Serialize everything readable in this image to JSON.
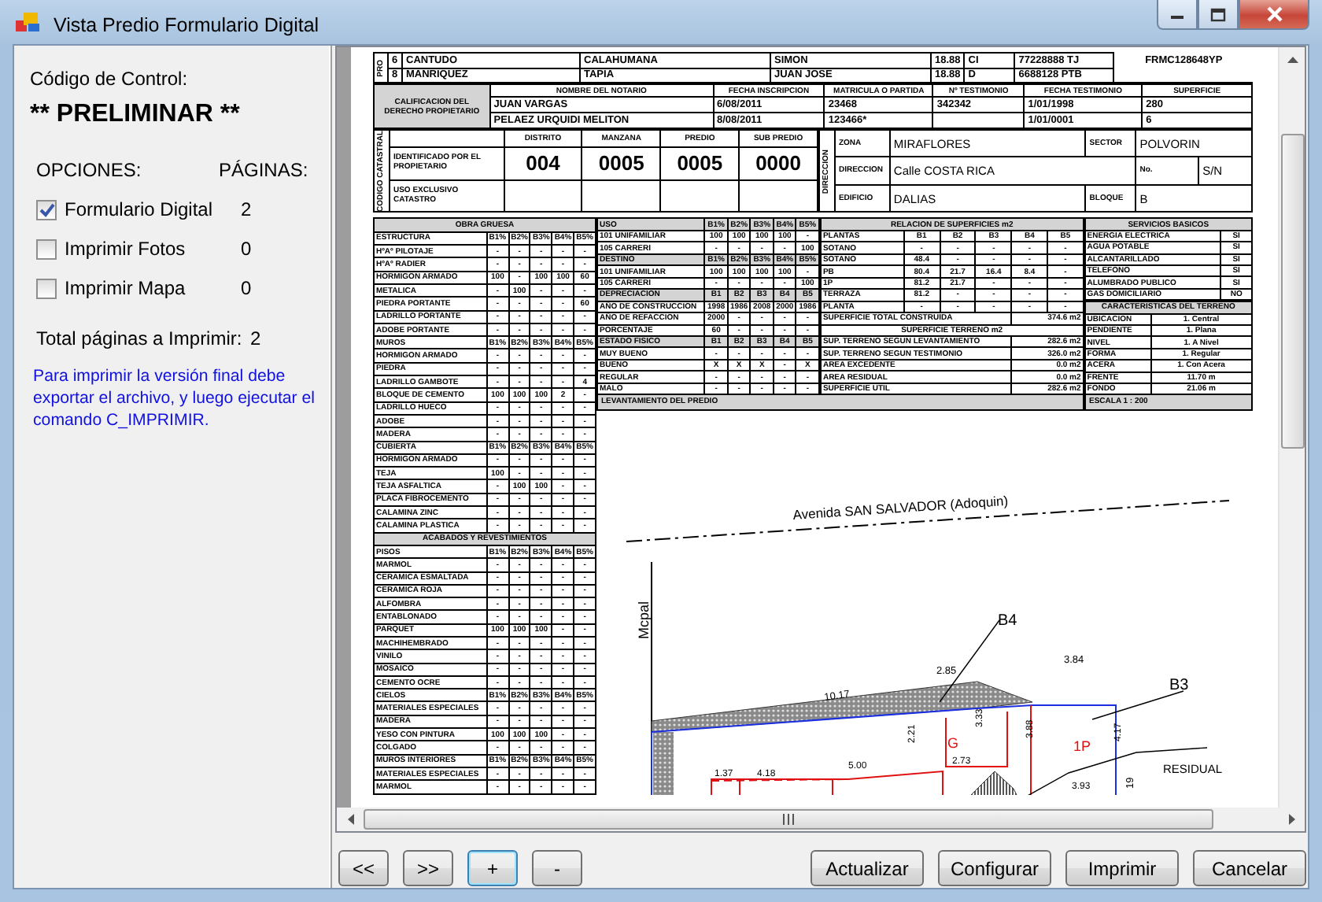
{
  "window": {
    "title": "Vista Predio Formulario Digital"
  },
  "control_panel": {
    "code_label": "Código de Control:",
    "code": "** PRELIMINAR **",
    "options_heading": "OPCIONES:",
    "pages_heading": "PÁGINAS:",
    "options": [
      {
        "label": "Formulario Digital",
        "checked": true,
        "pages": "2"
      },
      {
        "label": "Imprimir Fotos",
        "checked": false,
        "pages": "0"
      },
      {
        "label": "Imprimir Mapa",
        "checked": false,
        "pages": "0"
      }
    ],
    "total_label": "Total páginas a Imprimir:",
    "total": "2",
    "note": "Para imprimir la versión final debe exportar el archivo, y luego ejecutar el comando C_IMPRIMIR."
  },
  "document": {
    "owners": {
      "side_label": "PRO",
      "rows": [
        [
          "6",
          "CANTUDO",
          "CALAHUMANA",
          "SIMON",
          "18.88",
          "CI",
          "77228888 TJ"
        ],
        [
          "8",
          "MANRIQUEZ",
          "TAPIA",
          "JUAN JOSE",
          "18.88",
          "D",
          "6688128 PTB"
        ]
      ]
    },
    "form_code": "FRMC128648YP",
    "rights": {
      "label": "CALIFICACION DEL DERECHO PROPIETARIO",
      "columns": [
        "NOMBRE DEL NOTARIO",
        "FECHA INSCRIPCION",
        "MATRICULA O PARTIDA",
        "Nº TESTIMONIO",
        "FECHA TESTIMONIO",
        "SUPERFICIE"
      ],
      "rows": [
        [
          "JUAN VARGAS",
          "6/08/2011",
          "23468",
          "342342",
          "1/01/1998",
          "280"
        ],
        [
          "PELAEZ URQUIDI MELITON",
          "8/08/2011",
          "123466*",
          null,
          "1/01/0001",
          "6"
        ]
      ]
    },
    "cadastral": {
      "side_label": "CODIGO CATASTRAL",
      "columns": [
        "DISTRITO",
        "MANZANA",
        "PREDIO",
        "SUB PREDIO"
      ],
      "rows": [
        {
          "label": "IDENTIFICADO POR EL PROPIETARIO",
          "values": [
            "004",
            "0005",
            "0005",
            "0000"
          ]
        },
        {
          "label": "USO EXCLUSIVO CATASTRO"
        }
      ]
    },
    "address": {
      "side_label": "DIRECCION",
      "lines": [
        {
          "fields": [
            {
              "label": "ZONA",
              "value": "MIRAFLORES"
            },
            {
              "label": "SECTOR",
              "value": "POLVORIN"
            }
          ]
        },
        {
          "fields": [
            {
              "label": "DIRECCION",
              "value": "Calle COSTA RICA"
            },
            {
              "label": "No.",
              "value": "S/N"
            }
          ]
        },
        {
          "fields": [
            {
              "label": "EDIFICIO",
              "value": "DALIAS"
            },
            {
              "label": "BLOQUE",
              "value": "B"
            }
          ]
        }
      ]
    },
    "construction": {
      "rows": [
        {
          "shaded": true,
          "heading": "OBRA GRUESA"
        },
        {
          "shaded": false,
          "cells": [
            "ESTRUCTURA",
            "B1%",
            "B2%",
            "B3%",
            "B4%",
            "B5%"
          ]
        },
        {
          "shaded": false,
          "cells": [
            "HºAº PILOTAJE",
            "-",
            "-",
            "-",
            "-",
            "-"
          ]
        },
        {
          "shaded": false,
          "cells": [
            "HºAº RADIER",
            "-",
            "-",
            "-",
            "-",
            "-"
          ]
        },
        {
          "shaded": false,
          "cells": [
            "HORMIGON ARMADO",
            "100",
            "-",
            "100",
            "100",
            "60"
          ]
        },
        {
          "shaded": false,
          "cells": [
            "METALICA",
            "-",
            "100",
            "-",
            "-",
            "-"
          ]
        },
        {
          "shaded": false,
          "cells": [
            "PIEDRA PORTANTE",
            "-",
            "-",
            "-",
            "-",
            "60"
          ]
        },
        {
          "shaded": false,
          "cells": [
            "LADRILLO PORTANTE",
            "-",
            "-",
            "-",
            "-",
            "-"
          ]
        },
        {
          "shaded": false,
          "cells": [
            "ADOBE PORTANTE",
            "-",
            "-",
            "-",
            "-",
            "-"
          ]
        },
        {
          "shaded": false,
          "cells": [
            "MUROS",
            "B1%",
            "B2%",
            "B3%",
            "B4%",
            "B5%"
          ]
        },
        {
          "shaded": false,
          "cells": [
            "HORMIGON ARMADO",
            "-",
            "-",
            "-",
            "-",
            "-"
          ]
        },
        {
          "shaded": false,
          "cells": [
            "PIEDRA",
            "-",
            "-",
            "-",
            "-",
            "-"
          ]
        },
        {
          "shaded": false,
          "cells": [
            "LADRILLO GAMBOTE",
            "-",
            "-",
            "-",
            "-",
            "4"
          ]
        },
        {
          "shaded": false,
          "cells": [
            "BLOQUE DE CEMENTO",
            "100",
            "100",
            "100",
            "2",
            "-"
          ]
        },
        {
          "shaded": false,
          "cells": [
            "LADRILLO HUECO",
            "-",
            "-",
            "-",
            "-",
            "-"
          ]
        },
        {
          "shaded": false,
          "cells": [
            "ADOBE",
            "-",
            "-",
            "-",
            "-",
            "-"
          ]
        },
        {
          "shaded": false,
          "cells": [
            "MADERA",
            "-",
            "-",
            "-",
            "-",
            "-"
          ]
        },
        {
          "shaded": false,
          "cells": [
            "CUBIERTA",
            "B1%",
            "B2%",
            "B3%",
            "B4%",
            "B5%"
          ]
        },
        {
          "shaded": false,
          "cells": [
            "HORMIGON ARMADO",
            "-",
            "-",
            "-",
            "-",
            "-"
          ]
        },
        {
          "shaded": false,
          "cells": [
            "TEJA",
            "100",
            "-",
            "-",
            "-",
            "-"
          ]
        },
        {
          "shaded": false,
          "cells": [
            "TEJA ASFALTICA",
            "-",
            "100",
            "100",
            "-",
            "-"
          ]
        },
        {
          "shaded": false,
          "cells": [
            "PLACA FIBROCEMENTO",
            "-",
            "-",
            "-",
            "-",
            "-"
          ]
        },
        {
          "shaded": false,
          "cells": [
            "CALAMINA ZINC",
            "-",
            "-",
            "-",
            "-",
            "-"
          ]
        },
        {
          "shaded": false,
          "cells": [
            "CALAMINA PLASTICA",
            "-",
            "-",
            "-",
            "-",
            "-"
          ]
        },
        {
          "shaded": true,
          "heading": "ACABADOS Y REVESTIMIENTOS"
        },
        {
          "shaded": false,
          "cells": [
            "PISOS",
            "B1%",
            "B2%",
            "B3%",
            "B4%",
            "B5%"
          ]
        },
        {
          "shaded": false,
          "cells": [
            "MARMOL",
            "-",
            "-",
            "-",
            "-",
            "-"
          ]
        },
        {
          "shaded": false,
          "cells": [
            "CERAMICA ESMALTADA",
            "-",
            "-",
            "-",
            "-",
            "-"
          ]
        },
        {
          "shaded": false,
          "cells": [
            "CERAMICA ROJA",
            "-",
            "-",
            "-",
            "-",
            "-"
          ]
        },
        {
          "shaded": false,
          "cells": [
            "ALFOMBRA",
            "-",
            "-",
            "-",
            "-",
            "-"
          ]
        },
        {
          "shaded": false,
          "cells": [
            "ENTABLONADO",
            "-",
            "-",
            "-",
            "-",
            "-"
          ]
        },
        {
          "shaded": false,
          "cells": [
            "PARQUET",
            "100",
            "100",
            "100",
            "-",
            "-"
          ]
        },
        {
          "shaded": false,
          "cells": [
            "MACHIHEMBRADO",
            "-",
            "-",
            "-",
            "-",
            "-"
          ]
        },
        {
          "shaded": false,
          "cells": [
            "VINILO",
            "-",
            "-",
            "-",
            "-",
            "-"
          ]
        },
        {
          "shaded": false,
          "cells": [
            "MOSAICO",
            "-",
            "-",
            "-",
            "-",
            "-"
          ]
        },
        {
          "shaded": false,
          "cells": [
            "CEMENTO OCRE",
            "-",
            "-",
            "-",
            "-",
            "-"
          ]
        },
        {
          "shaded": false,
          "cells": [
            "CIELOS",
            "B1%",
            "B2%",
            "B3%",
            "B4%",
            "B5%"
          ]
        },
        {
          "shaded": false,
          "cells": [
            "MATERIALES ESPECIALES",
            "-",
            "-",
            "-",
            "-",
            "-"
          ]
        },
        {
          "shaded": false,
          "cells": [
            "MADERA",
            "-",
            "-",
            "-",
            "-",
            "-"
          ]
        },
        {
          "shaded": false,
          "cells": [
            "YESO CON PINTURA",
            "100",
            "100",
            "100",
            "-",
            "-"
          ]
        },
        {
          "shaded": false,
          "cells": [
            "COLGADO",
            "-",
            "-",
            "-",
            "-",
            "-"
          ]
        },
        {
          "shaded": false,
          "cells": [
            "MUROS INTERIORES",
            "B1%",
            "B2%",
            "B3%",
            "B4%",
            "B5%"
          ]
        },
        {
          "shaded": false,
          "cells": [
            "MATERIALES ESPECIALES",
            "-",
            "-",
            "-",
            "-",
            "-"
          ]
        },
        {
          "shaded": false,
          "cells": [
            "MARMOL",
            "-",
            "-",
            "-",
            "-",
            "-"
          ]
        }
      ]
    },
    "use": {
      "rows": [
        {
          "shaded": true,
          "cells": [
            "USO",
            "B1%",
            "B2%",
            "B3%",
            "B4%",
            "B5%"
          ]
        },
        {
          "shaded": false,
          "cells": [
            "101 UNIFAMILIAR",
            "100",
            "100",
            "100",
            "100",
            "-"
          ]
        },
        {
          "shaded": false,
          "cells": [
            "105 CARRERI",
            "-",
            "-",
            "-",
            "-",
            "100"
          ]
        },
        {
          "shaded": true,
          "cells": [
            "DESTINO",
            "B1%",
            "B2%",
            "B3%",
            "B4%",
            "B5%"
          ]
        },
        {
          "shaded": false,
          "cells": [
            "101 UNIFAMILIAR",
            "100",
            "100",
            "100",
            "100",
            "-"
          ]
        },
        {
          "shaded": false,
          "cells": [
            "105 CARRERI",
            "-",
            "-",
            "-",
            "-",
            "100"
          ]
        },
        {
          "shaded": true,
          "cells": [
            "DEPRECIACION",
            "B1",
            "B2",
            "B3",
            "B4",
            "B5"
          ]
        },
        {
          "shaded": false,
          "cells": [
            "AÑO DE CONSTRUCCION",
            "1998",
            "1986",
            "2008",
            "2000",
            "1986"
          ]
        },
        {
          "shaded": false,
          "cells": [
            "AÑO DE REFACCION",
            "2000",
            "-",
            "-",
            "-",
            "-"
          ]
        },
        {
          "shaded": false,
          "cells": [
            "PORCENTAJE",
            "60",
            "-",
            "-",
            "-",
            "-"
          ]
        },
        {
          "shaded": true,
          "cells": [
            "ESTADO FISICO",
            "B1",
            "B2",
            "B3",
            "B4",
            "B5"
          ]
        },
        {
          "shaded": false,
          "cells": [
            "MUY BUENO",
            "-",
            "-",
            "-",
            "-",
            "-"
          ]
        },
        {
          "shaded": false,
          "cells": [
            "BUENO",
            "X",
            "X",
            "X",
            "-",
            "X"
          ]
        },
        {
          "shaded": false,
          "cells": [
            "REGULAR",
            "-",
            "-",
            "-",
            "-",
            "-"
          ]
        },
        {
          "shaded": false,
          "cells": [
            "MALO",
            "-",
            "-",
            "-",
            "-",
            "-"
          ]
        }
      ]
    },
    "surfaces": {
      "rows": [
        {
          "shaded": true,
          "heading": "RELACION DE SUPERFICIES m2"
        },
        {
          "shaded": false,
          "cells": [
            "PLANTAS",
            "B1",
            "B2",
            "B3",
            "B4",
            "B5"
          ]
        },
        {
          "shaded": false,
          "cells": [
            "SOTANO",
            "-",
            "-",
            "-",
            "-",
            "-"
          ]
        },
        {
          "shaded": false,
          "cells": [
            "SOTANO",
            "48.4",
            "-",
            "-",
            "-",
            "-"
          ]
        },
        {
          "shaded": false,
          "cells": [
            "PB",
            "80.4",
            "21.7",
            "16.4",
            "8.4",
            "-"
          ]
        },
        {
          "shaded": false,
          "cells": [
            "1P",
            "81.2",
            "21.7",
            "-",
            "-",
            "-"
          ]
        },
        {
          "shaded": false,
          "cells": [
            "TERRAZA",
            "81.2",
            "-",
            "-",
            "-",
            "-"
          ]
        },
        {
          "shaded": false,
          "cells": [
            "PLANTA",
            "-",
            "-",
            "-",
            "-",
            "-"
          ]
        },
        {
          "shaded": false,
          "label": "SUPERFICIE TOTAL CONSTRUIDA",
          "value": "374.6 m2"
        },
        {
          "shaded": false,
          "heading": "SUPERFICIE TERRENO m2"
        },
        {
          "shaded": false,
          "label": "SUP. TERRENO SEGUN LEVANTAMIENTO",
          "value": "282.6 m2"
        },
        {
          "shaded": false,
          "label": "SUP. TERRENO SEGUN TESTIMONIO",
          "value": "326.0 m2"
        },
        {
          "shaded": false,
          "label": "AREA EXCEDENTE",
          "value": "0.0 m2"
        },
        {
          "shaded": false,
          "label": "AREA RESIDUAL",
          "value": "0.0 m2"
        },
        {
          "shaded": false,
          "label": "SUPERFICIE UTIL",
          "value": "282.6 m2"
        }
      ]
    },
    "services": {
      "rows": [
        {
          "shaded": true,
          "heading": "SERVICIOS BASICOS"
        },
        {
          "shaded": false,
          "cells": [
            "ENERGIA ELECTRICA",
            "SI"
          ]
        },
        {
          "shaded": false,
          "cells": [
            "AGUA POTABLE",
            "SI"
          ]
        },
        {
          "shaded": false,
          "cells": [
            "ALCANTARILLADO",
            "SI"
          ]
        },
        {
          "shaded": false,
          "cells": [
            "TELEFONO",
            "SI"
          ]
        },
        {
          "shaded": false,
          "cells": [
            "ALUMBRADO PUBLICO",
            "SI"
          ]
        },
        {
          "shaded": false,
          "cells": [
            "GAS DOMICILIARIO",
            "NO"
          ]
        }
      ]
    },
    "terrain": {
      "rows": [
        {
          "shaded": true,
          "heading": "CARACTERISTICAS DEL TERRENO"
        },
        {
          "shaded": false,
          "cells": [
            "UBICACION",
            "1. Central"
          ]
        },
        {
          "shaded": false,
          "cells": [
            "PENDIENTE",
            "1. Plana"
          ]
        },
        {
          "shaded": false,
          "cells": [
            "NIVEL",
            "1. A Nivel"
          ]
        },
        {
          "shaded": false,
          "cells": [
            "FORMA",
            "1. Regular"
          ]
        },
        {
          "shaded": false,
          "cells": [
            "ACERA",
            "1. Con Acera"
          ]
        },
        {
          "shaded": false,
          "cells": [
            "FRENTE",
            "11.70 m"
          ]
        },
        {
          "shaded": false,
          "cells": [
            "FONDO",
            "21.06 m"
          ]
        }
      ]
    },
    "survey_caption": "LEVANTAMIENTO DEL PREDIO",
    "scale": "ESCALA 1 : 200",
    "site_plan": {
      "street": "Avenida SAN SALVADOR (Adoquin)",
      "labels": [
        {
          "kind": "block",
          "text": "B4"
        },
        {
          "kind": "boundary",
          "text": "Mcpal"
        },
        {
          "kind": "dimension",
          "text": "3.84"
        },
        {
          "kind": "dimension",
          "text": "10.17"
        },
        {
          "kind": "dimension",
          "text": "2.85"
        },
        {
          "kind": "block",
          "text": "B3"
        },
        {
          "kind": "dimension",
          "text": "2.21"
        },
        {
          "kind": "dimension",
          "text": "3.33"
        },
        {
          "kind": "room",
          "text": "G"
        },
        {
          "kind": "dimension",
          "text": "3.88"
        },
        {
          "kind": "room",
          "text": "1P"
        },
        {
          "kind": "dimension",
          "text": "4.17"
        },
        {
          "kind": "dimension",
          "text": "2.73"
        },
        {
          "kind": "dimension",
          "text": "3.93"
        },
        {
          "kind": "dimension",
          "text": "1.37"
        },
        {
          "kind": "dimension",
          "text": "4.18"
        },
        {
          "kind": "dimension",
          "text": "5.00"
        },
        {
          "kind": "zone",
          "text": "RESIDUAL"
        },
        {
          "kind": "dimension",
          "text": "19"
        }
      ]
    }
  },
  "nav_buttons": [
    {
      "label": "<<",
      "focused": false
    },
    {
      "label": ">>",
      "focused": false
    },
    {
      "label": "+",
      "focused": true
    },
    {
      "label": "-",
      "focused": false
    }
  ],
  "action_buttons": [
    "Actualizar",
    "Configurar",
    "Imprimir",
    "Cancelar"
  ]
}
